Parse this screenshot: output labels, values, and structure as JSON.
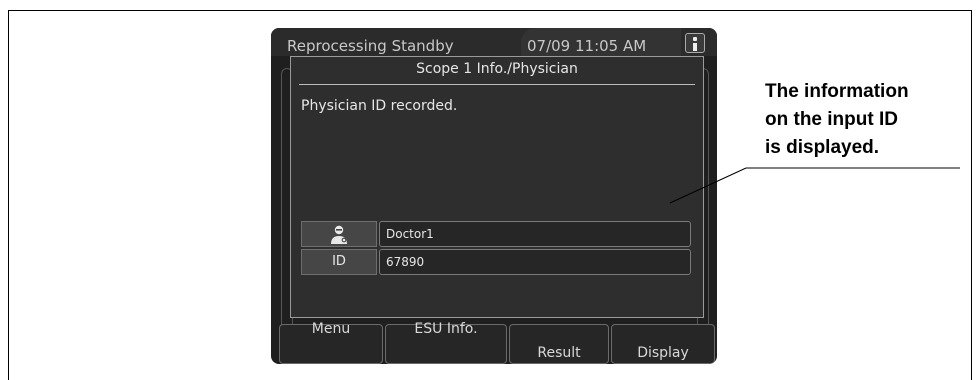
{
  "status_bar": {
    "title": "Reprocessing Standby",
    "datetime": "07/09 11:05 AM",
    "info_icon": "info-icon"
  },
  "dialog": {
    "title": "Scope 1 Info./Physician",
    "message": "Physician ID recorded.",
    "rows": [
      {
        "label_icon": "physician-icon",
        "value": "Doctor1"
      },
      {
        "label": "ID",
        "value": "67890"
      }
    ]
  },
  "bottom_buttons": [
    {
      "label": "Menu"
    },
    {
      "label": "ESU Info."
    },
    {
      "label": "Result"
    },
    {
      "label": "Display"
    }
  ],
  "annotation": {
    "lines": [
      "The information",
      "on the input ID",
      "is displayed."
    ]
  }
}
